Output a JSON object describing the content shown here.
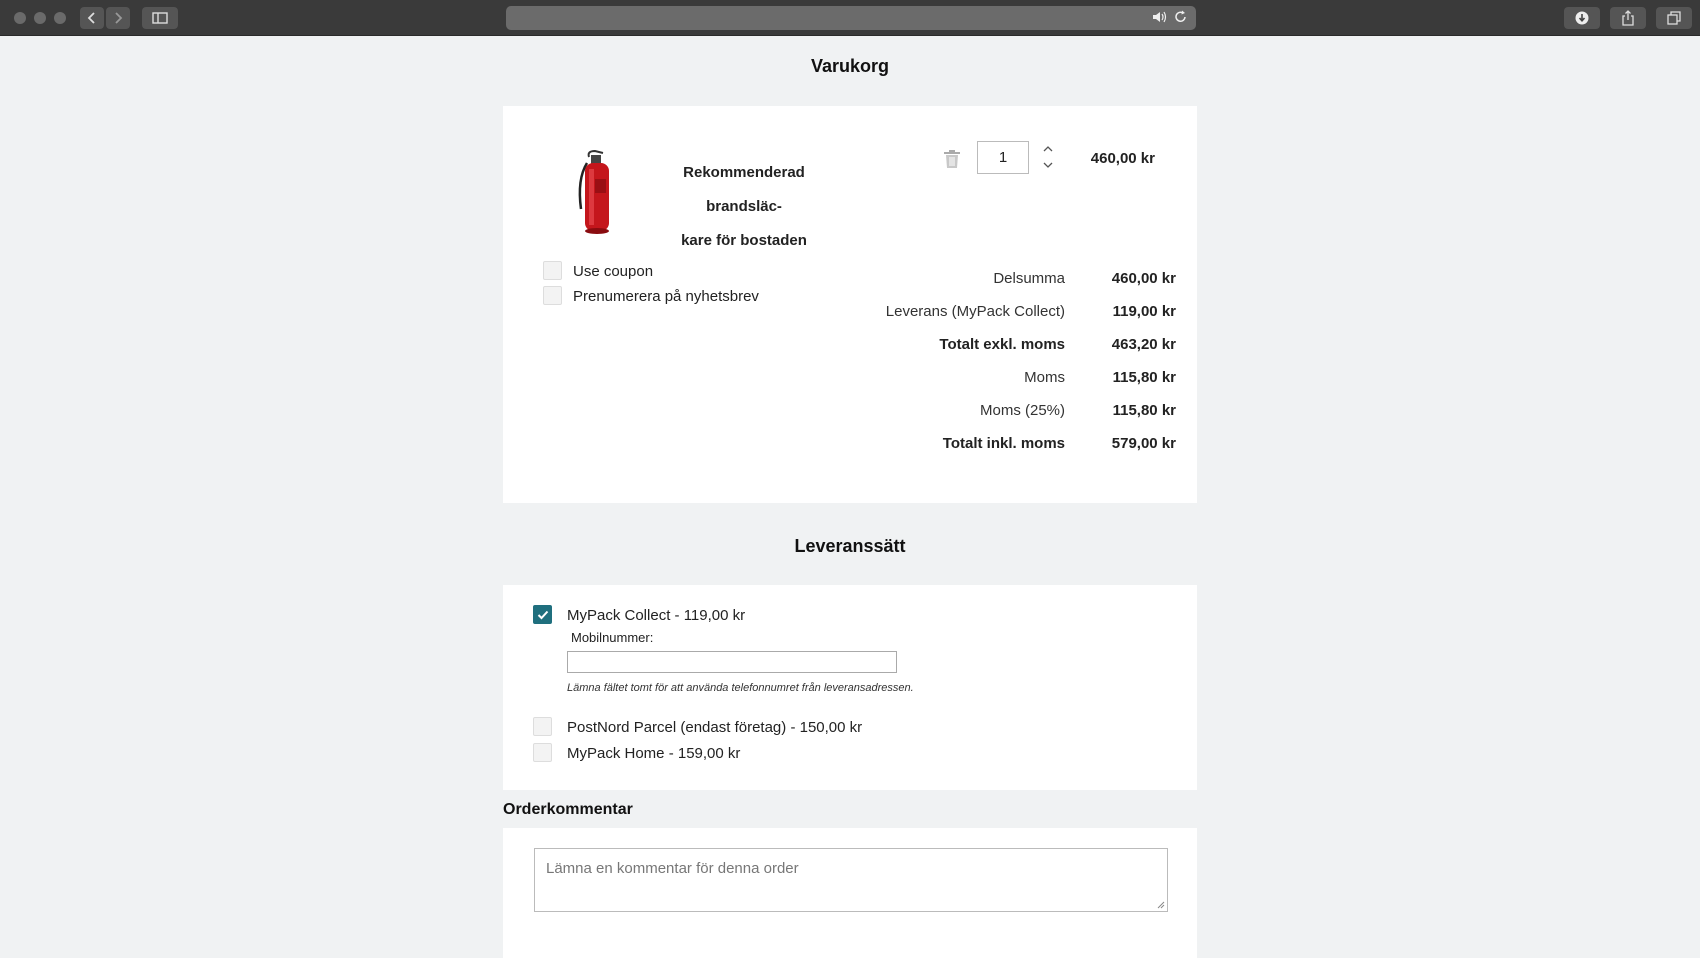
{
  "cart": {
    "title": "Varukorg",
    "product_name_line1": "Rekommenderad brandsläc-",
    "product_name_line2": "kare för bostaden",
    "quantity": "1",
    "line_price": "460,00 kr",
    "options": {
      "coupon_label": "Use coupon",
      "newsletter_label": "Prenumerera på nyhetsbrev"
    },
    "totals": [
      {
        "label": "Delsumma",
        "value": "460,00 kr",
        "bold": false
      },
      {
        "label": "Leverans (MyPack Collect)",
        "value": "119,00 kr",
        "bold": false
      },
      {
        "label": "Totalt exkl. moms",
        "value": "463,20 kr",
        "bold": true
      },
      {
        "label": "Moms",
        "value": "115,80 kr",
        "bold": false
      },
      {
        "label": "Moms (25%)",
        "value": "115,80 kr",
        "bold": false
      },
      {
        "label": "Totalt inkl. moms",
        "value": "579,00 kr",
        "bold": true
      }
    ]
  },
  "delivery": {
    "title": "Leveranssätt",
    "options": [
      {
        "label": "MyPack Collect - 119,00 kr",
        "checked": true
      },
      {
        "label": "PostNord Parcel (endast företag) - 150,00 kr",
        "checked": false
      },
      {
        "label": "MyPack Home - 159,00 kr",
        "checked": false
      }
    ],
    "mobile_label": "Mobilnummer:",
    "mobile_value": "",
    "mobile_hint": "Lämna fältet tomt för att använda telefonnumret från leveransadressen."
  },
  "comment": {
    "title": "Orderkommentar",
    "placeholder": "Lämna en kommentar för denna order"
  },
  "colors": {
    "accent": "#1f6f7e",
    "page_bg": "#f0f2f3",
    "chrome_bg": "#3a3a3a"
  }
}
